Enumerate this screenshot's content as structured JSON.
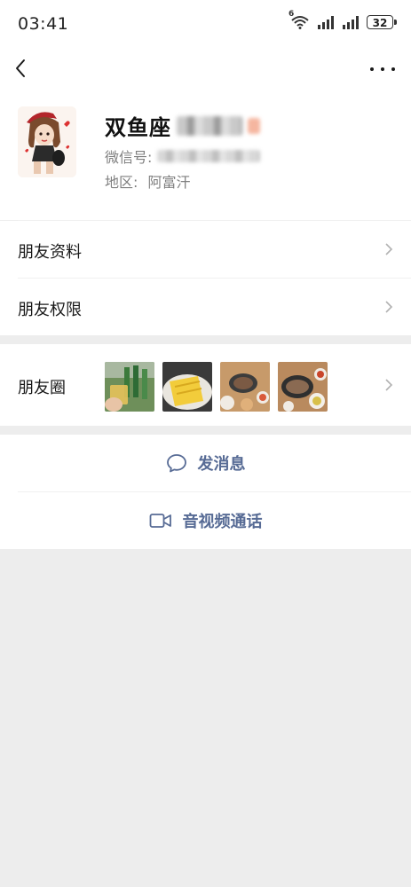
{
  "status_bar": {
    "time": "03:41",
    "network_label": "6",
    "battery": "32"
  },
  "profile": {
    "name": "双鱼座",
    "wechat_id_label": "微信号:",
    "region_label": "地区:",
    "region_value": "阿富汗"
  },
  "menu": {
    "friend_info": "朋友资料",
    "friend_permissions": "朋友权限",
    "moments": "朋友圈"
  },
  "actions": {
    "send_message": "发消息",
    "video_call": "音视频通话"
  },
  "colors": {
    "link": "#576b95",
    "background": "#ededed"
  }
}
